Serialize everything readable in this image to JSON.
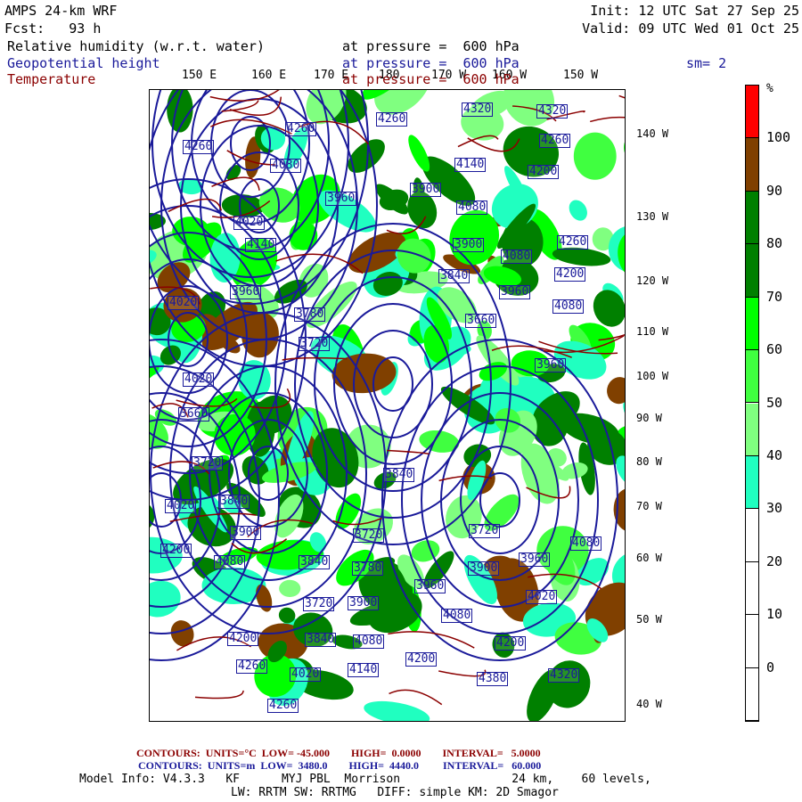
{
  "header": {
    "model": "AMPS 24-km WRF",
    "fcst": "Fcst:   93 h",
    "init": "Init: 12 UTC Sat 27 Sep 25",
    "valid": "Valid: 09 UTC Wed 01 Oct 25",
    "field1": "Relative humidity (w.r.t. water)",
    "field1_level": "at pressure =  600 hPa",
    "field2": "Geopotential height",
    "field2_level": "at pressure =  600 hPa",
    "smoothing": "sm= 2",
    "field3": "Temperature",
    "field3_level": "at pressure =  600 hPa"
  },
  "map": {
    "lon_labels": [
      "150 E",
      "160 E",
      "170 E",
      "180",
      "170 W",
      "160 W",
      "150 W"
    ],
    "lat_labels": [
      "140 W",
      "130 W",
      "120 W",
      "110 W",
      "100 W",
      "90 W",
      "80 W",
      "70 W",
      "60 W",
      "50 W",
      "40 W"
    ],
    "height_labels": [
      "4260",
      "4080",
      "4260",
      "4260",
      "4320",
      "4320",
      "4260",
      "4200",
      "4140",
      "3960",
      "3900",
      "4080",
      "4020",
      "4140",
      "3900",
      "4080",
      "4260",
      "4200",
      "3840",
      "3960",
      "3960",
      "4020",
      "3780",
      "4080",
      "3660",
      "3720",
      "4020",
      "3960",
      "3660",
      "3720",
      "3840",
      "4020",
      "3840",
      "3900",
      "3720",
      "3720",
      "4200",
      "4080",
      "3840",
      "3780",
      "3900",
      "3960",
      "4080",
      "3960",
      "4020",
      "3900",
      "4080",
      "3720",
      "4200",
      "3840",
      "4080",
      "4200",
      "4260",
      "4020",
      "4140",
      "4200",
      "4380",
      "4320",
      "4260"
    ],
    "colors": {
      "height": "#1a1a9a",
      "temperature": "#8b0000"
    }
  },
  "colorbar": {
    "unit": "%",
    "labels": [
      "100",
      "90",
      "80",
      "70",
      "60",
      "50",
      "40",
      "30",
      "20",
      "10",
      "0"
    ],
    "colors": [
      "#ff0000",
      "#804000",
      "#008000",
      "#008000",
      "#00ff00",
      "#40ff40",
      "#80ff80",
      "#20ffc0",
      "#ffffff",
      "#ffffff",
      "#ffffff",
      "#ffffff"
    ]
  },
  "footer": {
    "temp": {
      "label": "CONTOURS:",
      "units": "UNITS=°C",
      "low": "LOW= -45.000",
      "high": "HIGH=  0.0000",
      "interval": "INTERVAL=   5.0000"
    },
    "hgt": {
      "label": "CONTOURS:",
      "units": "UNITS=m",
      "low": "LOW=  3480.0",
      "high": "HIGH=  4440.0",
      "interval": "INTERVAL=   60.000"
    },
    "model_info": "Model Info: V4.3.3   KF      MYJ PBL  Morrison                24 km,    60 levels,",
    "physics": "LW: RRTM SW: RRTMG   DIFF: simple KM: 2D Smagor"
  }
}
